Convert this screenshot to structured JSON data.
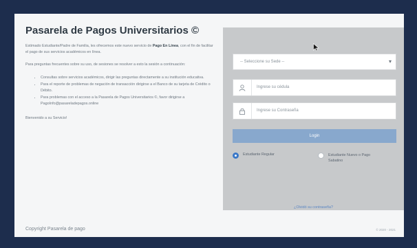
{
  "title": "Pasarela de Pagos Universitarios ©",
  "intro": {
    "before": "Estimado Estudiante/Padre de Familia, les ofrecemos este nuevo servicio de ",
    "bold": "Pago En Línea",
    "after": ", con el fin de facilitar el pago de sus servicios académicos en línea."
  },
  "help_text": "Para preguntas frecuentes sobre su uso, de sesiones se resolver a esto la sesión a continuación:",
  "bullets": [
    "Consultas sobre servicios académicos, dirigir las preguntas directamente a su institución educativa.",
    "Para el reporte de problemas de negación de transacción dirigirse a el Banco de su tarjeta de Crédito o Débito.",
    "Para problemas con el acceso a la Pasarela de Pagos Universitarios ©, favor dirigirse a PagoInfo@pasareladepagos.online"
  ],
  "welcome": "Bienvenido a su Servicio!",
  "login": {
    "select_placeholder": "-- Seleccione su Sede --",
    "cedula_placeholder": "Ingrese su cédula",
    "password_placeholder": "Ingrese su Contraseña",
    "button": "Login",
    "radio_regular": "Estudiante Regular",
    "radio_new": "Estudiante Nuevo o Pago Sabatino",
    "forgot": "¿Olvidó su contraseña?"
  },
  "footer": {
    "copyright": "Copyright Pasarela de pago",
    "year": "© 2020 - 2021"
  },
  "icons": {
    "user": "user-icon",
    "lock": "lock-icon",
    "chevron": "chevron-down-icon",
    "cursor": "mouse-pointer-icon"
  },
  "colors": {
    "background": "#1d2d4d",
    "panel": "#c7c9cb",
    "button": "#88a8cd",
    "radio_active": "#3a78c8",
    "link": "#5a86c4"
  }
}
